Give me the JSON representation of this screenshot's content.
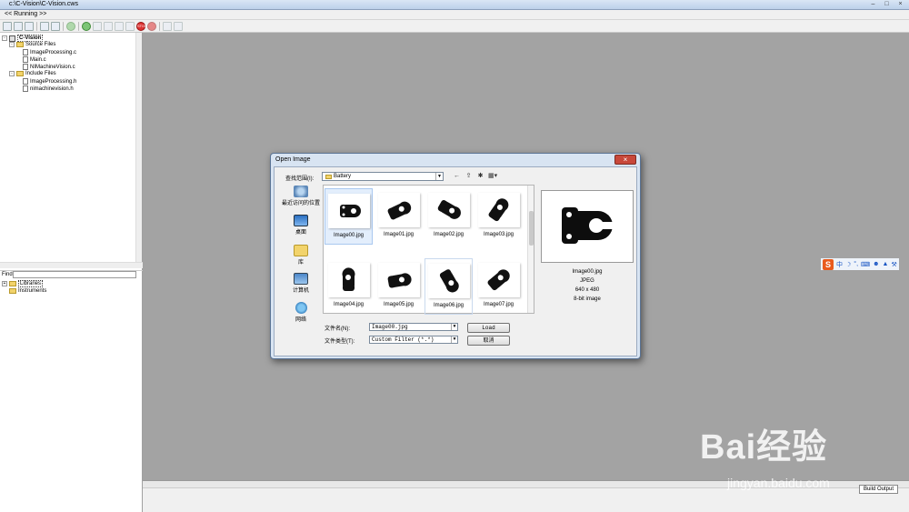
{
  "window": {
    "title": "c:\\C-Vision\\C-Vision.cws"
  },
  "menubar": {
    "running_label": "<< Running >>"
  },
  "project_tree": {
    "project": "C-Vision",
    "source_folder": "Source Files",
    "source_files": [
      "ImageProcessing.c",
      "Main.c",
      "NIMachineVision.c"
    ],
    "include_folder": "Include Files",
    "include_files": [
      "ImageProcessing.h",
      "nimachinevision.h"
    ]
  },
  "find": {
    "label": "Find"
  },
  "library_tree": {
    "items": [
      "Libraries",
      "Instruments"
    ]
  },
  "bottom": {
    "build_output_tab": "Build Output"
  },
  "dialog": {
    "title": "Open Image",
    "lookin_label": "查找范围(I):",
    "lookin_value": "Battery",
    "places": [
      "最近访问的位置",
      "桌面",
      "库",
      "计算机",
      "网络"
    ],
    "files": [
      "Image00.jpg",
      "Image01.jpg",
      "Image02.jpg",
      "Image03.jpg",
      "Image04.jpg",
      "Image05.jpg",
      "Image06.jpg",
      "Image07.jpg"
    ],
    "selected_file": "Image00.jpg",
    "preview_info": {
      "name": "Image00.jpg",
      "format": "JPEG",
      "size": "640 x 480",
      "depth": "8-bit image"
    },
    "filename_label": "文件名(N):",
    "filename_value": "Image00.jpg",
    "filetype_label": "文件类型(T):",
    "filetype_value": "Custom Filter (*.*)",
    "load_button": "Load",
    "cancel_button": "取消"
  },
  "watermark": {
    "brand": "Bai经验",
    "url": "jingyan.baidu.com"
  },
  "colors": {
    "workspace": "#a3a3a3",
    "dialog_frame": "#d8e4f2",
    "close_button": "#c8483a"
  }
}
